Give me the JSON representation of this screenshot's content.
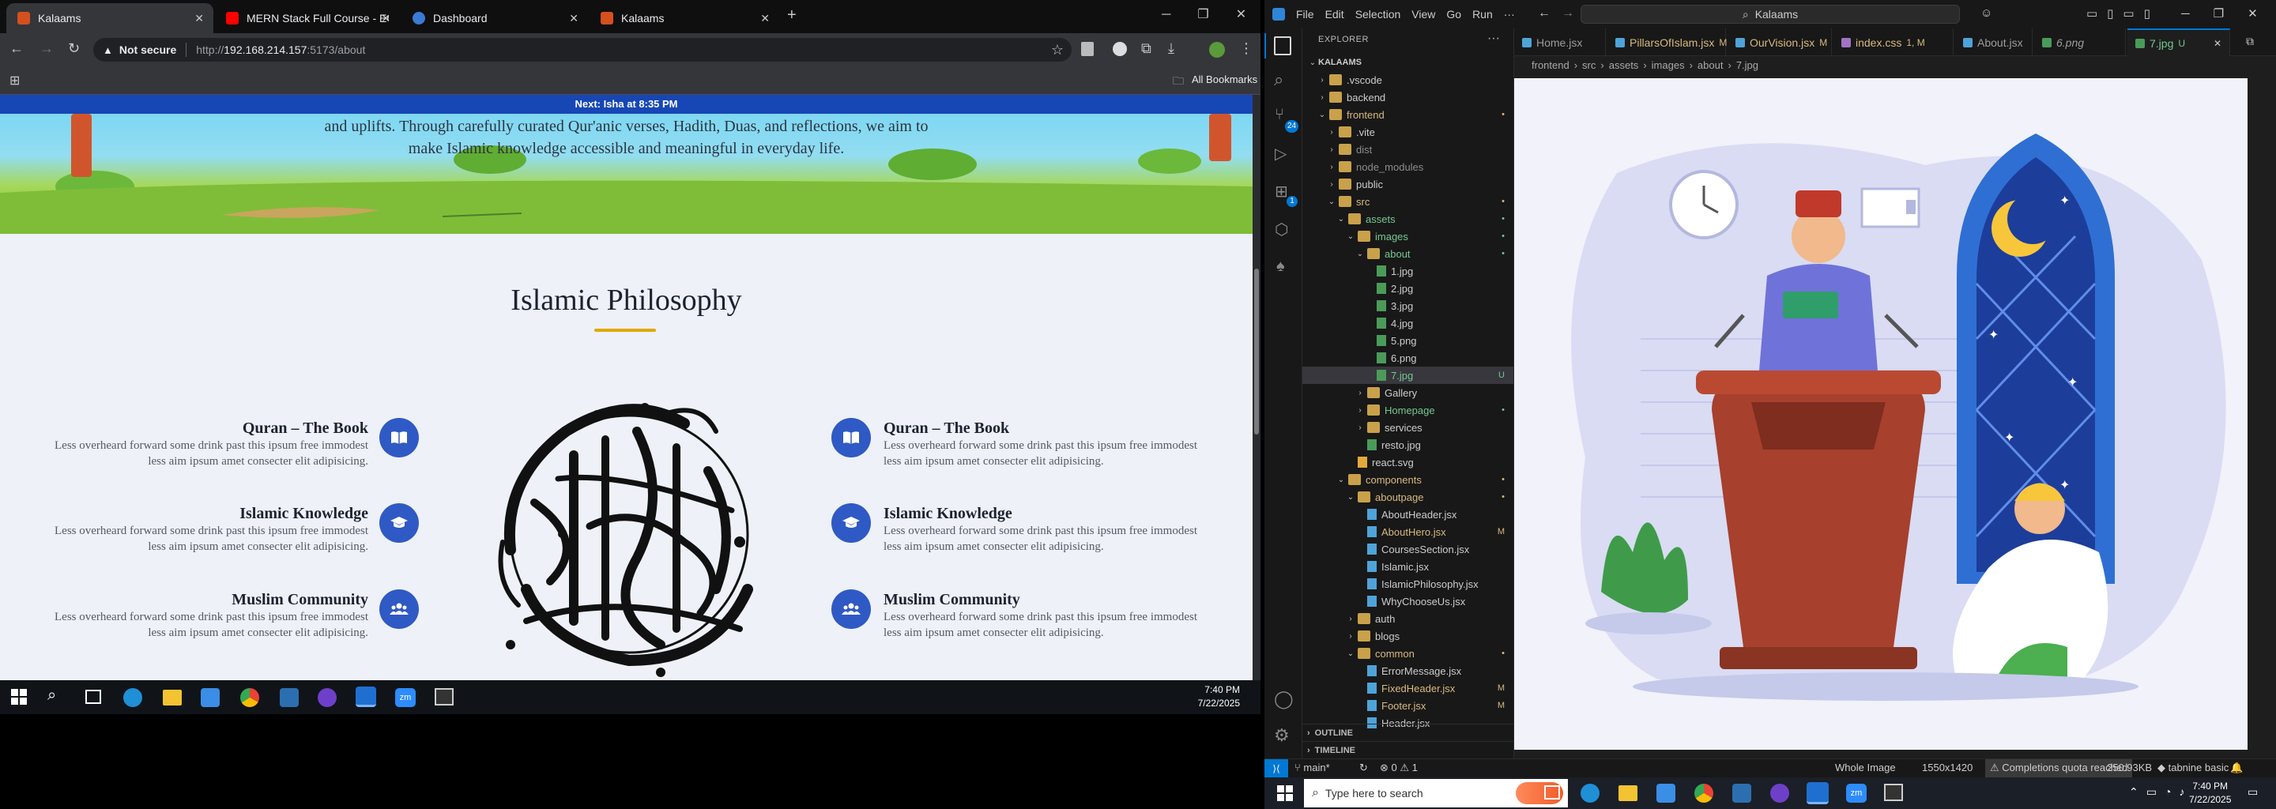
{
  "browser": {
    "tabs": [
      {
        "label": "Kalaams",
        "active": true
      },
      {
        "label": "MERN Stack Full Course - ECom",
        "active": false
      },
      {
        "label": "Dashboard",
        "active": false
      },
      {
        "label": "Kalaams",
        "active": false
      }
    ],
    "security": "Not secure",
    "url_prefix": "http://",
    "url_host": "192.168.214.157",
    "url_path": ":5173/about",
    "bookmarks_label": "All Bookmarks"
  },
  "page": {
    "next_prayer": "Next: Isha at 8:35 PM",
    "hero_text_line1": "and uplifts. Through carefully curated Qur'anic verses, Hadith, Duas, and reflections, we aim to",
    "hero_text_line2": "make Islamic knowledge accessible and meaningful in everyday life.",
    "section_title": "Islamic Philosophy",
    "features_left": [
      {
        "title": "Quran – The Book",
        "line1": "Less overheard forward some drink past this ipsum free immodest",
        "line2": "less aim ipsum amet consecter elit adipisicing.",
        "icon": "book-icon"
      },
      {
        "title": "Islamic Knowledge",
        "line1": "Less overheard forward some drink past this ipsum free immodest",
        "line2": "less aim ipsum amet consecter elit adipisicing.",
        "icon": "graduation-cap-icon"
      },
      {
        "title": "Muslim Community",
        "line1": "Less overheard forward some drink past this ipsum free immodest",
        "line2": "less aim ipsum amet consecter elit adipisicing.",
        "icon": "users-icon"
      }
    ],
    "features_right": [
      {
        "title": "Quran – The Book",
        "line1": "Less overheard forward some drink past this ipsum free immodest",
        "line2": "less aim ipsum amet consecter elit adipisicing.",
        "icon": "book-icon"
      },
      {
        "title": "Islamic Knowledge",
        "line1": "Less overheard forward some drink past this ipsum free immodest",
        "line2": "less aim ipsum amet consecter elit adipisicing.",
        "icon": "graduation-cap-icon"
      },
      {
        "title": "Muslim Community",
        "line1": "Less overheard forward some drink past this ipsum free immodest",
        "line2": "less aim ipsum amet consecter elit adipisicing.",
        "icon": "users-icon"
      }
    ],
    "accent": "#2f59c4",
    "underline_color": "#e0a800"
  },
  "taskbar_left": {
    "time": "7:40 PM",
    "date": "7/22/2025"
  },
  "vscode": {
    "menu": [
      "File",
      "Edit",
      "Selection",
      "View",
      "Go",
      "Run",
      "···"
    ],
    "search": "Kalaams",
    "explorer_title": "EXPLORER",
    "tree": [
      {
        "label": "KALAAMS",
        "depth": 0,
        "type": "root",
        "color": "#cccccc",
        "status": ""
      },
      {
        "label": ".vscode",
        "depth": 1,
        "type": "folder",
        "color": "#cccccc",
        "status": ""
      },
      {
        "label": "backend",
        "depth": 1,
        "type": "folder",
        "color": "#cccccc",
        "status": ""
      },
      {
        "label": "frontend",
        "depth": 1,
        "type": "folder-open",
        "color": "#d7ba7d",
        "status": "•"
      },
      {
        "label": ".vite",
        "depth": 2,
        "type": "folder",
        "color": "#cccccc",
        "status": ""
      },
      {
        "label": "dist",
        "depth": 2,
        "type": "folder",
        "color": "#8c8c8c",
        "status": ""
      },
      {
        "label": "node_modules",
        "depth": 2,
        "type": "folder",
        "color": "#8c8c8c",
        "status": ""
      },
      {
        "label": "public",
        "depth": 2,
        "type": "folder",
        "color": "#cccccc",
        "status": ""
      },
      {
        "label": "src",
        "depth": 2,
        "type": "folder-open",
        "color": "#d7ba7d",
        "status": "•"
      },
      {
        "label": "assets",
        "depth": 3,
        "type": "folder-open",
        "color": "#73c991",
        "status": "•"
      },
      {
        "label": "images",
        "depth": 4,
        "type": "folder-open",
        "color": "#73c991",
        "status": "•"
      },
      {
        "label": "about",
        "depth": 5,
        "type": "folder-open",
        "color": "#73c991",
        "status": "•"
      },
      {
        "label": "1.jpg",
        "depth": 6,
        "type": "image",
        "color": "#cccccc",
        "status": ""
      },
      {
        "label": "2.jpg",
        "depth": 6,
        "type": "image",
        "color": "#cccccc",
        "status": ""
      },
      {
        "label": "3.jpg",
        "depth": 6,
        "type": "image",
        "color": "#cccccc",
        "status": ""
      },
      {
        "label": "4.jpg",
        "depth": 6,
        "type": "image",
        "color": "#cccccc",
        "status": ""
      },
      {
        "label": "5.png",
        "depth": 6,
        "type": "image",
        "color": "#cccccc",
        "status": ""
      },
      {
        "label": "6.png",
        "depth": 6,
        "type": "image",
        "color": "#cccccc",
        "status": ""
      },
      {
        "label": "7.jpg",
        "depth": 6,
        "type": "image",
        "color": "#73c991",
        "status": "U",
        "selected": true
      },
      {
        "label": "Gallery",
        "depth": 5,
        "type": "folder",
        "color": "#cccccc",
        "status": ""
      },
      {
        "label": "Homepage",
        "depth": 5,
        "type": "folder",
        "color": "#73c991",
        "status": "•"
      },
      {
        "label": "services",
        "depth": 5,
        "type": "folder",
        "color": "#cccccc",
        "status": ""
      },
      {
        "label": "resto.jpg",
        "depth": 5,
        "type": "image",
        "color": "#cccccc",
        "status": ""
      },
      {
        "label": "react.svg",
        "depth": 4,
        "type": "svg",
        "color": "#cccccc",
        "status": ""
      },
      {
        "label": "components",
        "depth": 3,
        "type": "folder-open",
        "color": "#d7ba7d",
        "status": "•"
      },
      {
        "label": "aboutpage",
        "depth": 4,
        "type": "folder-open",
        "color": "#d7ba7d",
        "status": "•"
      },
      {
        "label": "AboutHeader.jsx",
        "depth": 5,
        "type": "jsx",
        "color": "#cccccc",
        "status": ""
      },
      {
        "label": "AboutHero.jsx",
        "depth": 5,
        "type": "jsx",
        "color": "#d7ba7d",
        "status": "M"
      },
      {
        "label": "CoursesSection.jsx",
        "depth": 5,
        "type": "jsx",
        "color": "#cccccc",
        "status": ""
      },
      {
        "label": "Islamic.jsx",
        "depth": 5,
        "type": "jsx",
        "color": "#cccccc",
        "status": ""
      },
      {
        "label": "IslamicPhilosophy.jsx",
        "depth": 5,
        "type": "jsx",
        "color": "#cccccc",
        "status": ""
      },
      {
        "label": "WhyChooseUs.jsx",
        "depth": 5,
        "type": "jsx",
        "color": "#cccccc",
        "status": ""
      },
      {
        "label": "auth",
        "depth": 4,
        "type": "folder",
        "color": "#cccccc",
        "status": ""
      },
      {
        "label": "blogs",
        "depth": 4,
        "type": "folder",
        "color": "#cccccc",
        "status": ""
      },
      {
        "label": "common",
        "depth": 4,
        "type": "folder-open",
        "color": "#d7ba7d",
        "status": "•"
      },
      {
        "label": "ErrorMessage.jsx",
        "depth": 5,
        "type": "jsx",
        "color": "#cccccc",
        "status": ""
      },
      {
        "label": "FixedHeader.jsx",
        "depth": 5,
        "type": "jsx",
        "color": "#d7ba7d",
        "status": "M"
      },
      {
        "label": "Footer.jsx",
        "depth": 5,
        "type": "jsx",
        "color": "#d7ba7d",
        "status": "M"
      },
      {
        "label": "Header.jsx",
        "depth": 5,
        "type": "jsx",
        "color": "#cccccc",
        "status": ""
      }
    ],
    "outline": "OUTLINE",
    "timeline": "TIMELINE",
    "editor_tabs": [
      {
        "label": "Home.jsx",
        "status": "",
        "color": "#9d9d9d"
      },
      {
        "label": "PillarsOfIslam.jsx",
        "status": "M",
        "color": "#d7ba7d"
      },
      {
        "label": "OurVision.jsx",
        "status": "M",
        "color": "#d7ba7d"
      },
      {
        "label": "index.css",
        "status": "1, M",
        "color": "#d7ba7d"
      },
      {
        "label": "About.jsx",
        "status": "",
        "color": "#9d9d9d"
      },
      {
        "label": "6.png",
        "status": "",
        "color": "#9d9d9d"
      },
      {
        "label": "7.jpg",
        "status": "U",
        "color": "#73c991",
        "active": true
      }
    ],
    "breadcrumbs": [
      "frontend",
      "src",
      "assets",
      "images",
      "about",
      "7.jpg"
    ],
    "status": {
      "branch": "main*",
      "problems": "⊗ 0 ⚠ 1",
      "zoom": "Whole Image",
      "dims": "1550x1420",
      "quota": "Completions quota reached",
      "size": "250.93KB",
      "tabnine": "tabnine basic"
    },
    "activity_badges": {
      "scm": "24",
      "extensions": "1"
    }
  },
  "taskbar_right": {
    "search_placeholder": "Type here to search",
    "time": "7:40 PM",
    "date": "7/22/2025"
  }
}
